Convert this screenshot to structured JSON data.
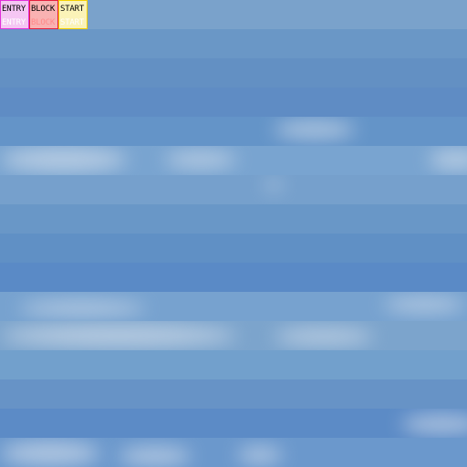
{
  "toolbar": {
    "tiles": [
      {
        "id": "entry",
        "label": "ENTRY",
        "bg": "#f5c6f3",
        "border": "#e030d8",
        "label_color": "#ffffff"
      },
      {
        "id": "block",
        "label": "BLOCK",
        "bg": "#f9b2b2",
        "border": "#e41e3c",
        "label_color": "#ff8a8a"
      },
      {
        "id": "start",
        "label": "START",
        "bg": "#fbf3b8",
        "border": "#f4d000",
        "label_color": "#ffffff"
      }
    ]
  },
  "sky": {
    "bands": [
      "#7aa2cb",
      "#6a97c6",
      "#6390c3",
      "#5f8cc4",
      "#6494c8",
      "#79a4d0",
      "#76a0cc",
      "#6997c7",
      "#6090c5",
      "#5a8ac6",
      "#77a2cf",
      "#7ca4cc",
      "#72a0cc",
      "#6793c6",
      "#5c8bc6",
      "#6b98cc"
    ],
    "accent": "#5f8ec4",
    "cloud_color": "#e8ecf2"
  }
}
